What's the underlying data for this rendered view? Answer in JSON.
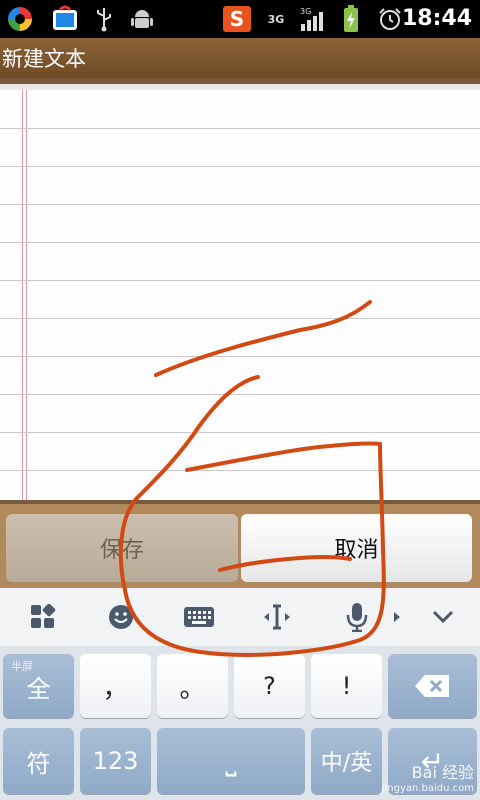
{
  "status_bar": {
    "time": "18:44",
    "network_label": "3G",
    "network_label_small": "3G"
  },
  "title_bar": {
    "title": "新建文本"
  },
  "buttons": {
    "save_label": "保存",
    "cancel_label": "取消"
  },
  "ime_toolbar": {
    "items": [
      "grid-icon",
      "emoji-icon",
      "keyboard-icon",
      "cursor-icon",
      "microphone-icon",
      "chevron-down-icon"
    ]
  },
  "keyboard": {
    "row1": {
      "half_full_small": "半屏",
      "half_full": "全",
      "comma": "，",
      "period": "。",
      "question": "?",
      "exclaim": "!"
    },
    "row2": {
      "symbol": "符",
      "numbers": "123",
      "space": "⎵",
      "lang": "中/英",
      "enter": "↵"
    }
  },
  "watermark": {
    "text": "Bai 经验",
    "sub": "jingyan.baidu.com"
  },
  "colors": {
    "stroke": "#d14a14",
    "title_bg": "#7b5530"
  }
}
